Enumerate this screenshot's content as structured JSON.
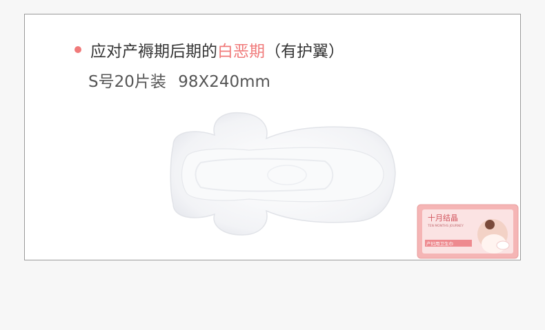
{
  "headline": {
    "prefix": "应对产褥期后期的",
    "highlight": "白恶期",
    "suffix": "（有护翼）"
  },
  "spec": {
    "count": "S号20片装",
    "size": "98X240mm"
  },
  "package": {
    "brand": "十月结晶",
    "brand_en": "TEN MONTHS JOURNEY",
    "product": "产妇用卫生巾"
  },
  "colors": {
    "accent": "#f07a7a",
    "card_bg": "#ffffff",
    "page_bg": "#f7f7f7",
    "package_pink": "#f5b5b5"
  },
  "icons": [
    "bullet-dot-icon"
  ]
}
